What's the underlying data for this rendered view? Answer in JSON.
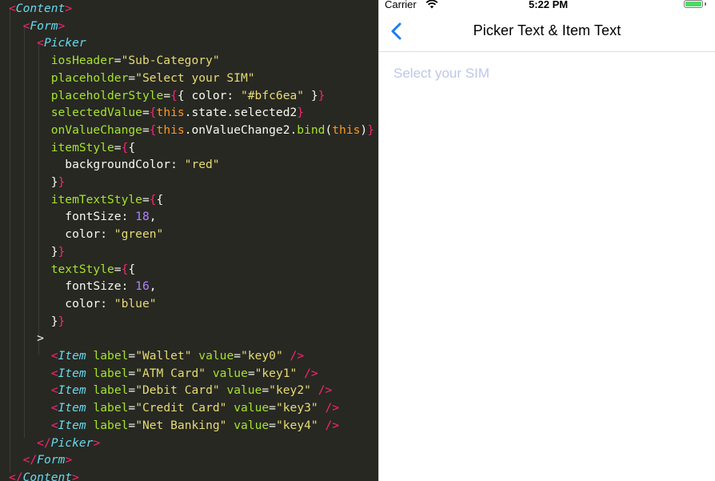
{
  "editor": {
    "lines": [
      [
        [
          "t-tag",
          "<"
        ],
        [
          "t-comp",
          "Content"
        ],
        [
          "t-tag",
          ">"
        ]
      ],
      [
        [
          "t-plain",
          "  "
        ],
        [
          "t-tag",
          "<"
        ],
        [
          "t-comp",
          "Form"
        ],
        [
          "t-tag",
          ">"
        ]
      ],
      [
        [
          "t-plain",
          "    "
        ],
        [
          "t-tag",
          "<"
        ],
        [
          "t-comp",
          "Picker"
        ]
      ],
      [
        [
          "t-plain",
          "      "
        ],
        [
          "t-attr",
          "iosHeader"
        ],
        [
          "t-plain",
          "="
        ],
        [
          "t-str",
          "\"Sub-Category\""
        ]
      ],
      [
        [
          "t-plain",
          "      "
        ],
        [
          "t-attr",
          "placeholder"
        ],
        [
          "t-plain",
          "="
        ],
        [
          "t-str",
          "\"Select your SIM\""
        ]
      ],
      [
        [
          "t-plain",
          "      "
        ],
        [
          "t-attr",
          "placeholderStyle"
        ],
        [
          "t-plain",
          "="
        ],
        [
          "t-br",
          "{"
        ],
        [
          "t-plain",
          "{ color: "
        ],
        [
          "t-str",
          "\"#bfc6ea\""
        ],
        [
          "t-plain",
          " }"
        ],
        [
          "t-br",
          "}"
        ]
      ],
      [
        [
          "t-plain",
          "      "
        ],
        [
          "t-attr",
          "selectedValue"
        ],
        [
          "t-plain",
          "="
        ],
        [
          "t-br",
          "{"
        ],
        [
          "t-kw",
          "this"
        ],
        [
          "t-plain",
          ".state.selected2"
        ],
        [
          "t-br",
          "}"
        ]
      ],
      [
        [
          "t-plain",
          "      "
        ],
        [
          "t-attr",
          "onValueChange"
        ],
        [
          "t-plain",
          "="
        ],
        [
          "t-br",
          "{"
        ],
        [
          "t-kw",
          "this"
        ],
        [
          "t-plain",
          ".onValueChange2."
        ],
        [
          "t-attr",
          "bind"
        ],
        [
          "t-plain",
          "("
        ],
        [
          "t-kw",
          "this"
        ],
        [
          "t-plain",
          ")"
        ],
        [
          "t-br",
          "}"
        ]
      ],
      [
        [
          "t-plain",
          "      "
        ],
        [
          "t-attr",
          "itemStyle"
        ],
        [
          "t-plain",
          "="
        ],
        [
          "t-br",
          "{"
        ],
        [
          "t-plain",
          "{"
        ]
      ],
      [
        [
          "t-plain",
          "        backgroundColor: "
        ],
        [
          "t-str",
          "\"red\""
        ]
      ],
      [
        [
          "t-plain",
          "      }"
        ],
        [
          "t-br",
          "}"
        ]
      ],
      [
        [
          "t-plain",
          "      "
        ],
        [
          "t-attr",
          "itemTextStyle"
        ],
        [
          "t-plain",
          "="
        ],
        [
          "t-br",
          "{"
        ],
        [
          "t-plain",
          "{"
        ]
      ],
      [
        [
          "t-plain",
          "        fontSize: "
        ],
        [
          "t-num",
          "18"
        ],
        [
          "t-plain",
          ","
        ]
      ],
      [
        [
          "t-plain",
          "        color: "
        ],
        [
          "t-str",
          "\"green\""
        ]
      ],
      [
        [
          "t-plain",
          "      }"
        ],
        [
          "t-br",
          "}"
        ]
      ],
      [
        [
          "t-plain",
          "      "
        ],
        [
          "t-attr",
          "textStyle"
        ],
        [
          "t-plain",
          "="
        ],
        [
          "t-br",
          "{"
        ],
        [
          "t-plain",
          "{"
        ]
      ],
      [
        [
          "t-plain",
          "        fontSize: "
        ],
        [
          "t-num",
          "16"
        ],
        [
          "t-plain",
          ","
        ]
      ],
      [
        [
          "t-plain",
          "        color: "
        ],
        [
          "t-str",
          "\"blue\""
        ]
      ],
      [
        [
          "t-plain",
          "      }"
        ],
        [
          "t-br",
          "}"
        ]
      ],
      [
        [
          "t-plain",
          "    >"
        ]
      ],
      [
        [
          "t-plain",
          "      "
        ],
        [
          "t-tag",
          "<"
        ],
        [
          "t-comp",
          "Item"
        ],
        [
          "t-plain",
          " "
        ],
        [
          "t-attr",
          "label"
        ],
        [
          "t-plain",
          "="
        ],
        [
          "t-str",
          "\"Wallet\""
        ],
        [
          "t-plain",
          " "
        ],
        [
          "t-attr",
          "value"
        ],
        [
          "t-plain",
          "="
        ],
        [
          "t-str",
          "\"key0\""
        ],
        [
          "t-plain",
          " "
        ],
        [
          "t-tag",
          "/>"
        ]
      ],
      [
        [
          "t-plain",
          "      "
        ],
        [
          "t-tag",
          "<"
        ],
        [
          "t-comp",
          "Item"
        ],
        [
          "t-plain",
          " "
        ],
        [
          "t-attr",
          "label"
        ],
        [
          "t-plain",
          "="
        ],
        [
          "t-str",
          "\"ATM Card\""
        ],
        [
          "t-plain",
          " "
        ],
        [
          "t-attr",
          "value"
        ],
        [
          "t-plain",
          "="
        ],
        [
          "t-str",
          "\"key1\""
        ],
        [
          "t-plain",
          " "
        ],
        [
          "t-tag",
          "/>"
        ]
      ],
      [
        [
          "t-plain",
          "      "
        ],
        [
          "t-tag",
          "<"
        ],
        [
          "t-comp",
          "Item"
        ],
        [
          "t-plain",
          " "
        ],
        [
          "t-attr",
          "label"
        ],
        [
          "t-plain",
          "="
        ],
        [
          "t-str",
          "\"Debit Card\""
        ],
        [
          "t-plain",
          " "
        ],
        [
          "t-attr",
          "value"
        ],
        [
          "t-plain",
          "="
        ],
        [
          "t-str",
          "\"key2\""
        ],
        [
          "t-plain",
          " "
        ],
        [
          "t-tag",
          "/>"
        ]
      ],
      [
        [
          "t-plain",
          "      "
        ],
        [
          "t-tag",
          "<"
        ],
        [
          "t-comp",
          "Item"
        ],
        [
          "t-plain",
          " "
        ],
        [
          "t-attr",
          "label"
        ],
        [
          "t-plain",
          "="
        ],
        [
          "t-str",
          "\"Credit Card\""
        ],
        [
          "t-plain",
          " "
        ],
        [
          "t-attr",
          "value"
        ],
        [
          "t-plain",
          "="
        ],
        [
          "t-str",
          "\"key3\""
        ],
        [
          "t-plain",
          " "
        ],
        [
          "t-tag",
          "/>"
        ]
      ],
      [
        [
          "t-plain",
          "      "
        ],
        [
          "t-tag",
          "<"
        ],
        [
          "t-comp",
          "Item"
        ],
        [
          "t-plain",
          " "
        ],
        [
          "t-attr",
          "label"
        ],
        [
          "t-plain",
          "="
        ],
        [
          "t-str",
          "\"Net Banking\""
        ],
        [
          "t-plain",
          " "
        ],
        [
          "t-attr",
          "value"
        ],
        [
          "t-plain",
          "="
        ],
        [
          "t-str",
          "\"key4\""
        ],
        [
          "t-plain",
          " "
        ],
        [
          "t-tag",
          "/>"
        ]
      ],
      [
        [
          "t-plain",
          "    "
        ],
        [
          "t-tag",
          "</"
        ],
        [
          "t-comp",
          "Picker"
        ],
        [
          "t-tag",
          ">"
        ]
      ],
      [
        [
          "t-plain",
          "  "
        ],
        [
          "t-tag",
          "</"
        ],
        [
          "t-comp",
          "Form"
        ],
        [
          "t-tag",
          ">"
        ]
      ],
      [
        [
          "t-tag",
          "</"
        ],
        [
          "t-comp",
          "Content"
        ],
        [
          "t-tag",
          ">"
        ]
      ]
    ]
  },
  "status_bar": {
    "carrier": "Carrier",
    "time": "5:22 PM"
  },
  "nav": {
    "title": "Picker Text & Item Text",
    "back_icon": "chevron-left-icon"
  },
  "picker": {
    "placeholder": "Select your SIM",
    "placeholder_color": "#bfc6ea"
  },
  "colors": {
    "accent": "#1a7cf5",
    "battery": "#4cd964",
    "editor_bg": "#272822"
  }
}
